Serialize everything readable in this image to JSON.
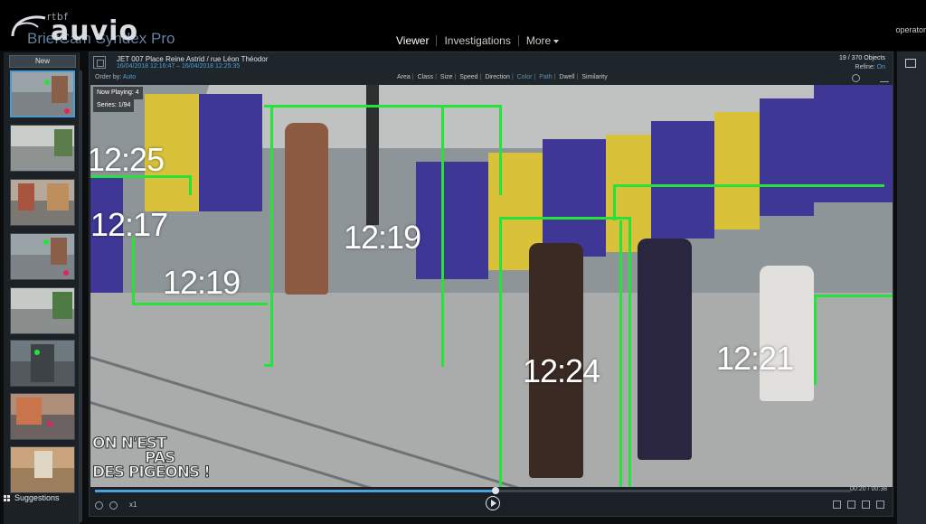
{
  "broadcaster": {
    "small": "rtbf",
    "big": "auvio"
  },
  "app": {
    "name": "BriefCam Syndex Pro"
  },
  "nav": {
    "viewer": "Viewer",
    "investigations": "Investigations",
    "more": "More"
  },
  "user": {
    "name": "operator"
  },
  "left_panel": {
    "new_label": "New",
    "suggestions_label": "Suggestions",
    "thumbnails": [
      {
        "name": "cam-1",
        "selected": true
      },
      {
        "name": "cam-2",
        "selected": false
      },
      {
        "name": "cam-3",
        "selected": false
      },
      {
        "name": "cam-4",
        "selected": false
      },
      {
        "name": "cam-5",
        "selected": false
      },
      {
        "name": "cam-6",
        "selected": false
      },
      {
        "name": "cam-7",
        "selected": false
      },
      {
        "name": "cam-8",
        "selected": false
      }
    ]
  },
  "camera": {
    "title": "JET 007 Place Reine Astrid / rue Léon Théodor",
    "time_range": "16/04/2018 12:16:47 – 16/04/2018 12:25:35",
    "order_label": "Order by:",
    "order_value": "Auto",
    "objects": "19 / 370 Objects",
    "refine_label": "Refine:",
    "refine_value": "On"
  },
  "filters": [
    {
      "label": "Area",
      "active": true
    },
    {
      "label": "Class",
      "active": true
    },
    {
      "label": "Size",
      "active": true
    },
    {
      "label": "Speed",
      "active": true
    },
    {
      "label": "Direction",
      "active": true
    },
    {
      "label": "Color",
      "active": false
    },
    {
      "label": "Path",
      "active": false
    },
    {
      "label": "Dwell",
      "active": true
    },
    {
      "label": "Similarity",
      "active": true
    }
  ],
  "video": {
    "overlay_1": "Now Playing: 4",
    "overlay_2": "Series: 1/94",
    "timestamps": [
      "12:25",
      "12:17",
      "12:19",
      "12:19",
      "12:24",
      "12:21"
    ],
    "watermark": {
      "line1": "ON N'EST",
      "line2": "PAS",
      "line3": "DES PIGEONS !"
    }
  },
  "controls": {
    "position": "00:20",
    "duration": "00:38",
    "progress": 0.53,
    "speed": "x1"
  },
  "colors": {
    "track_green": "#25e33b",
    "accent_blue": "#4aa1dc"
  }
}
